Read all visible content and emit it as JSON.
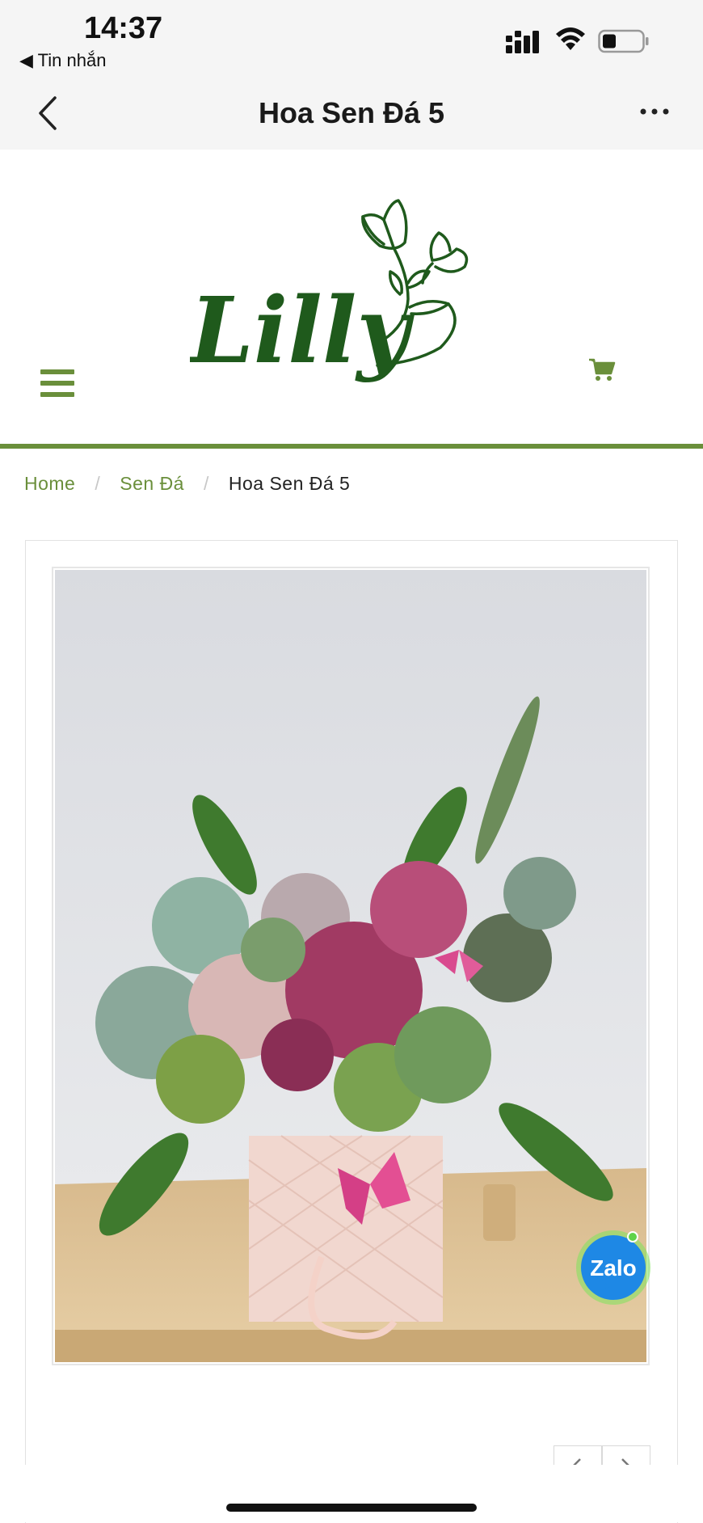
{
  "status_bar": {
    "time": "14:37",
    "back_app_label": "◀ Tin nhắn"
  },
  "nav": {
    "title": "Hoa Sen Đá 5"
  },
  "site": {
    "logo_text": "Lilly",
    "brand_color": "#6a8f3b"
  },
  "breadcrumb": {
    "home": "Home",
    "category": "Sen Đá",
    "current": "Hoa Sen Đá 5"
  },
  "zalo": {
    "label": "Zalo"
  },
  "icons": {
    "back": "chevron-left-icon",
    "more": "more-horizontal-icon",
    "menu": "hamburger-icon",
    "cart": "cart-icon",
    "prev": "chevron-left-icon",
    "next": "chevron-right-icon"
  }
}
